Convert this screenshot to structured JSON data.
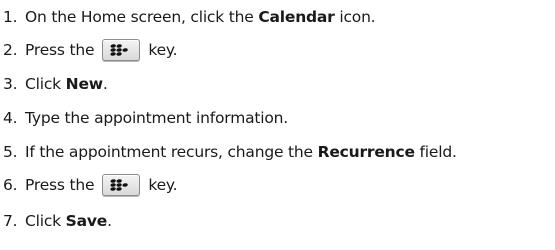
{
  "steps": [
    {
      "num": "1.",
      "pre": "On the Home screen, click the ",
      "bold": "Calendar",
      "post": " icon."
    },
    {
      "num": "2.",
      "pre": "Press the",
      "key_icon": "blackberry-menu-key-icon",
      "post": "key."
    },
    {
      "num": "3.",
      "pre": "Click ",
      "bold": "New",
      "post": "."
    },
    {
      "num": "4.",
      "text": "Type the appointment information."
    },
    {
      "num": "5.",
      "pre": "If the appointment recurs, change the ",
      "bold": "Recurrence",
      "post": " field."
    },
    {
      "num": "6.",
      "pre": "Press the",
      "key_icon": "blackberry-menu-key-icon",
      "post": "key."
    },
    {
      "num": "7.",
      "pre": "Click ",
      "bold": "Save",
      "post": "."
    }
  ]
}
